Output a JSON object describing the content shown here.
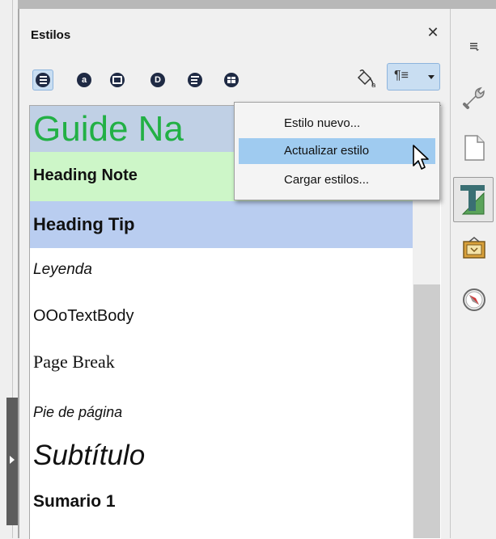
{
  "panel": {
    "title": "Estilos",
    "close_glyph": "✕"
  },
  "toolbar": {
    "families": [
      {
        "name": "paragraph-styles-icon",
        "glyph": "≡",
        "active": true
      },
      {
        "name": "character-styles-icon",
        "glyph": "a",
        "active": false
      },
      {
        "name": "frame-styles-icon",
        "glyph": "□",
        "active": false
      },
      {
        "name": "page-styles-icon",
        "glyph": "D",
        "active": false
      },
      {
        "name": "list-styles-icon",
        "glyph": "⋮≡",
        "active": false
      },
      {
        "name": "table-styles-icon",
        "glyph": "▦",
        "active": false
      }
    ],
    "fill_format_icon": "paint-bucket-icon",
    "style_actions_glyph": "¶≡"
  },
  "style_list": {
    "items": [
      {
        "label": "Guide Na",
        "style": "guide"
      },
      {
        "label": "Heading Note",
        "style": "heading-note"
      },
      {
        "label": "Heading Tip",
        "style": "heading-tip"
      },
      {
        "label": "Leyenda",
        "style": "caption"
      },
      {
        "label": "OOoTextBody",
        "style": "textbody"
      },
      {
        "label": "Page Break",
        "style": "pagebreak"
      },
      {
        "label": "Pie de página",
        "style": "footer"
      },
      {
        "label": "Subtítulo",
        "style": "subtitle"
      },
      {
        "label": "Sumario 1",
        "style": "contents1"
      }
    ]
  },
  "menu": {
    "items": [
      {
        "label": "Estilo nuevo...",
        "hover": false
      },
      {
        "label": "Actualizar estilo",
        "hover": true
      },
      {
        "label": "Cargar estilos...",
        "hover": false
      }
    ]
  },
  "sidebar": {
    "buttons": [
      {
        "name": "sidebar-menu-icon"
      },
      {
        "name": "properties-wrench-icon"
      },
      {
        "name": "page-icon"
      },
      {
        "name": "styles-icon",
        "active": true
      },
      {
        "name": "gallery-icon"
      },
      {
        "name": "navigator-compass-icon"
      }
    ]
  },
  "colors": {
    "guide_text": "#22b045",
    "selection_blue": "#c0d0e5",
    "note_green": "#cdf6c8",
    "tip_blue": "#b9cdf0",
    "menu_hover": "#9fcbf0"
  }
}
